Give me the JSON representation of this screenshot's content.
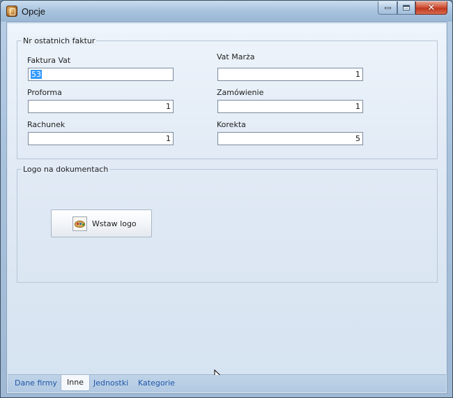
{
  "window": {
    "title": "Opcje"
  },
  "groups": {
    "invoice_numbers": {
      "legend": "Nr ostatnich faktur",
      "fields": [
        {
          "label": "Faktura Vat",
          "value": "53"
        },
        {
          "label": "Vat Marża",
          "value": "1"
        },
        {
          "label": "Proforma",
          "value": "1"
        },
        {
          "label": "Zamówienie",
          "value": "1"
        },
        {
          "label": "Rachunek",
          "value": "1"
        },
        {
          "label": "Korekta",
          "value": "5"
        }
      ]
    },
    "logo": {
      "legend": "Logo na dokumentach",
      "insert_button_label": "Wstaw logo"
    }
  },
  "tabs": [
    {
      "label": "Dane firmy",
      "active": false
    },
    {
      "label": "Inne",
      "active": true
    },
    {
      "label": "Jednostki",
      "active": false
    },
    {
      "label": "Kategorie",
      "active": false
    }
  ],
  "icons": {
    "app": "app-icon",
    "minimize": "minimize-icon",
    "maximize": "maximize-icon",
    "close": "close-icon",
    "logo_button": "palette-icon",
    "cursor": "mouse-cursor-icon"
  },
  "colors": {
    "selection": "#3399ff",
    "close_button": "#c0391f",
    "tab_link": "#1f57a8"
  }
}
